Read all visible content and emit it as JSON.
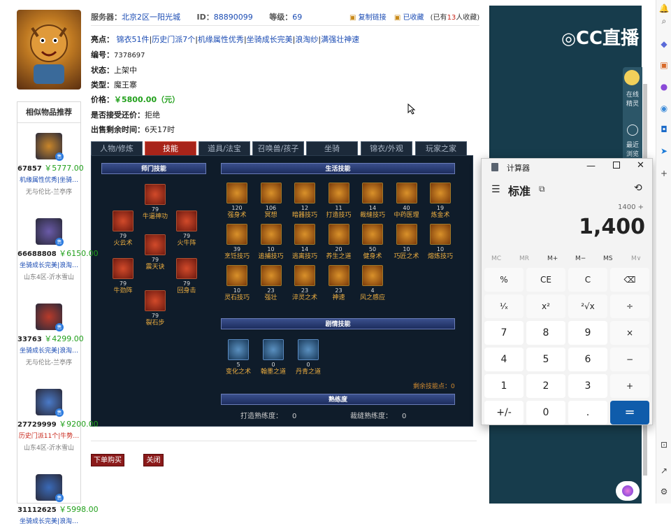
{
  "header": {
    "server_label": "服务器：",
    "server": "北京2区一阳光城",
    "id_label": "ID：",
    "id": "88890099",
    "level_label": "等级：",
    "level": "69",
    "copy_link": "复制链接",
    "collected": "已收藏",
    "collect_prefix": "(已有",
    "collect_count": "13",
    "collect_suffix": "人收藏)"
  },
  "highlights": {
    "label": "亮点：",
    "items": [
      "锦衣51件",
      "历史门派7个",
      "机缘属性优秀",
      "坐骑成长完美",
      "浪淘纱",
      "满强壮神速"
    ]
  },
  "info": {
    "number_label": "编号：",
    "number": "7378697",
    "status_label": "状态：",
    "status": "上架中",
    "type_label": "类型：",
    "type": "魔王寨",
    "price_label": "价格：",
    "price": "￥5800.00（元）",
    "bargain_label": "是否接受还价：",
    "bargain": "拒绝",
    "time_label": "出售剩余时间：",
    "time": "6天17时"
  },
  "tabs": [
    "人物/修炼",
    "技能",
    "道具/法宝",
    "召唤兽/孩子",
    "坐骑",
    "锦衣/外观",
    "玩家之家"
  ],
  "sections": {
    "school": "师门技能",
    "life": "生活技能",
    "plot": "剧情技能",
    "proficiency": "熟练度"
  },
  "school_skills": [
    {
      "lv": "79",
      "name": "牛逼神功"
    },
    {
      "lv": "79",
      "name": "火云术"
    },
    {
      "lv": "79",
      "name": "火牛阵"
    },
    {
      "lv": "79",
      "name": "震天诀"
    },
    {
      "lv": "79",
      "name": "牛劲阵"
    },
    {
      "lv": "79",
      "name": "回身击"
    },
    {
      "lv": "79",
      "name": "裂石步"
    }
  ],
  "life_skills": [
    {
      "lv": "120",
      "name": "强身术"
    },
    {
      "lv": "106",
      "name": "冥想"
    },
    {
      "lv": "12",
      "name": "暗器技巧"
    },
    {
      "lv": "11",
      "name": "打造技巧"
    },
    {
      "lv": "14",
      "name": "裁缝技巧"
    },
    {
      "lv": "40",
      "name": "中药医理"
    },
    {
      "lv": "19",
      "name": "炼金术"
    },
    {
      "lv": "39",
      "name": "烹饪技巧"
    },
    {
      "lv": "10",
      "name": "追捕技巧"
    },
    {
      "lv": "14",
      "name": "逃离技巧"
    },
    {
      "lv": "20",
      "name": "养生之道"
    },
    {
      "lv": "50",
      "name": "健身术"
    },
    {
      "lv": "10",
      "name": "巧匠之术"
    },
    {
      "lv": "10",
      "name": "熔炼技巧"
    },
    {
      "lv": "10",
      "name": "灵石技巧"
    },
    {
      "lv": "23",
      "name": "强壮"
    },
    {
      "lv": "23",
      "name": "淬灵之术"
    },
    {
      "lv": "23",
      "name": "神速"
    },
    {
      "lv": "4",
      "name": "风之感应"
    }
  ],
  "plot_skills": [
    {
      "lv": "5",
      "name": "变化之术"
    },
    {
      "lv": "0",
      "name": "翰墨之道"
    },
    {
      "lv": "0",
      "name": "丹青之道"
    }
  ],
  "remaining_points": "剩余技能点：0",
  "proficiency": {
    "forge_label": "打造熟练度：",
    "forge": "0",
    "tailor_label": "裁缝熟练度：",
    "tailor": "0"
  },
  "buttons": {
    "buy": "下单购买",
    "close": "关闭"
  },
  "similar": {
    "title": "相似物品推荐",
    "items": [
      {
        "id": "67857",
        "price": "￥5777.00",
        "desc": "机缘属性优秀|坐骑…",
        "server": "无与伦比-兰亭序",
        "color": "#c9862a",
        "red": false
      },
      {
        "id": "66688808",
        "price": "￥6150.00",
        "desc": "坐骑成长完美|浪淘…",
        "server": "山东4区-沂水雪山",
        "color": "#6a5aa8",
        "red": false
      },
      {
        "id": "33763",
        "price": "￥4299.00",
        "desc": "坐骑成长完美|浪淘…",
        "server": "无与伦比-兰亭序",
        "color": "#b83a2a",
        "red": false
      },
      {
        "id": "27729999",
        "price": "￥9200.00",
        "desc": "历史门派11个|牛势…",
        "server": "山东4区-沂水雪山",
        "color": "#4a7ac8",
        "red": true
      },
      {
        "id": "31112625",
        "price": "￥5998.00",
        "desc": "坐骑成长完美|浪淘…",
        "server": "",
        "color": "#3a6ab8",
        "red": false
      }
    ]
  },
  "stream": {
    "logo": "CC直播",
    "online_spirit": "在线\n精灵",
    "recent": "最近\n浏览"
  },
  "calculator": {
    "app_title": "计算器",
    "mode": "标准",
    "expression": "1400 +",
    "display": "1,400",
    "memory": [
      "MC",
      "MR",
      "M+",
      "M−",
      "MS",
      "M∨"
    ],
    "keys": [
      "%",
      "CE",
      "C",
      "⌫",
      "¹⁄ₓ",
      "x²",
      "²√x",
      "÷",
      "7",
      "8",
      "9",
      "×",
      "4",
      "5",
      "6",
      "−",
      "1",
      "2",
      "3",
      "+",
      "+/-",
      "0",
      ".",
      "="
    ]
  },
  "colors": {
    "accent": "#0f5cab",
    "price_green": "#22a01c",
    "link_blue": "#1a4bb3",
    "tab_active": "#a8241a"
  }
}
